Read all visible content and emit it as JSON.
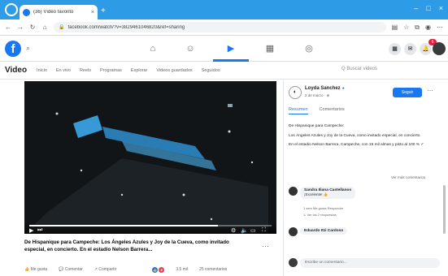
{
  "browser": {
    "tab_title": "(36) Vídeo favorito",
    "tab_close": "×",
    "new_tab": "+",
    "url": "facebook.com/watch/?v=3829461046820&ref=sharing",
    "window_controls": [
      "–",
      "□",
      "×"
    ]
  },
  "fb": {
    "logo": "f",
    "notifications_count": "6"
  },
  "subnav": {
    "title": "Video",
    "items": [
      "Inicio",
      "En vivo",
      "Reels",
      "Programas",
      "Explorar",
      "Videos guardados",
      "Seguidos"
    ],
    "search_placeholder": "Q  Buscar videos"
  },
  "video": {
    "progress": 0.78,
    "title": "De Hispanique para Campeche: Los Ángeles Azules y Joy de la Cueva, como invitado especial, en concierto. En el estadio Nelson Barrera...",
    "actions": [
      "Me gusta",
      "Comentar",
      "Compartir"
    ],
    "reaction_count": "3.5 mil",
    "comment_count": "25 comentarios"
  },
  "panel": {
    "page_name": "Loyda Sanchez",
    "page_meta": "2 de marzo · ⊕",
    "follow_label": "Seguir",
    "tabs": [
      "Resumen",
      "Comentarios"
    ],
    "description": [
      "De Hispanique para Campeche:",
      "Los Ángeles Azules y Joy de la Cueva, como invitado especial, en concierto.",
      "En el estadio Nelson Barrera, Campeche, con 15 mil almas y pisto al 100 % ✓"
    ],
    "more_comments": "Ver más comentarios",
    "comments": [
      {
        "name": "Sandra Iliana Castellanos",
        "text": "¡Excelente! 👍",
        "meta": "1 sem  Me gusta  Responder",
        "replies": "↳ Ver las 2 respuestas"
      },
      {
        "name": "Eduardo Itzi Cardoso",
        "text": "",
        "meta": "",
        "replies": ""
      }
    ],
    "comment_placeholder": "Escribe un comentario..."
  },
  "colors": {
    "browser_bar": "#2d9be6",
    "fb_blue": "#1877f2",
    "video_bg": "#111417",
    "stage_light": "#3aa0e0"
  }
}
